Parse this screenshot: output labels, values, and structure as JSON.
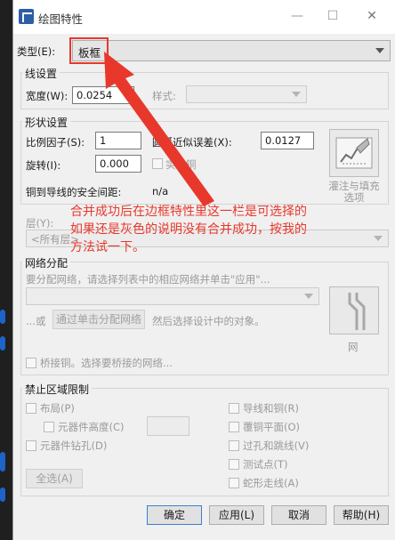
{
  "window": {
    "title": "绘图特性"
  },
  "type_row": {
    "label": "类型(E):",
    "value": "板框"
  },
  "line_settings": {
    "title": "线设置",
    "width_label": "宽度(W):",
    "width_value": "0.0254",
    "style_label": "样式:"
  },
  "shape_settings": {
    "title": "形状设置",
    "scale_label": "比例因子(S):",
    "scale_value": "1",
    "arc_label": "圆弧近似误差(X):",
    "arc_value": "0.0127",
    "rotate_label": "旋转(I):",
    "rotate_value": "0.000",
    "solid_label": "实心铜",
    "clearance_label": "铜到导线的安全间距:",
    "clearance_value": "n/a",
    "fill_label": "灌注与填充选项"
  },
  "layer": {
    "label": "层(Y):",
    "value": "<所有层>"
  },
  "net": {
    "title": "网络分配",
    "instruction": "要分配网络，请选择列表中的相应网络并单击\"应用\"...",
    "or_text": "...或",
    "assign_button": "通过单击分配网络",
    "after_text": "然后选择设计中的对象。",
    "net_button": "网",
    "bridge_label": "桥接铜。选择要桥接的网络..."
  },
  "keepout": {
    "title": "禁止区域限制",
    "left_items": [
      "布局(P)",
      "元器件高度(C)",
      "元器件钻孔(D)"
    ],
    "right_items": [
      "导线和铜(R)",
      "覆铜平面(O)",
      "过孔和跳线(V)",
      "测试点(T)",
      "蛇形走线(A)"
    ],
    "select_all": "全选(A)"
  },
  "buttons": {
    "ok": "确定",
    "apply": "应用(L)",
    "cancel": "取消",
    "help": "帮助(H)"
  },
  "annotation": {
    "line1": "合并成功后在边框特性里这一栏是可选择的",
    "line2": "如果还是灰色的说明没有合并成功，按我的",
    "line3": "方法试一下。"
  },
  "colors": {
    "annotation": "#e8382c",
    "arrow": "#e8382c"
  }
}
